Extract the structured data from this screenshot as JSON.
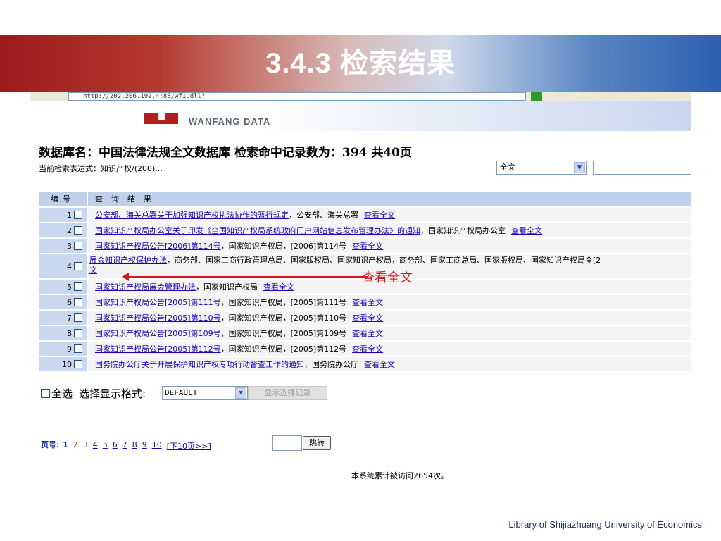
{
  "slide": {
    "title": "3.4.3 检索结果",
    "footer": "Library of Shijiazhuang University of Economics"
  },
  "browser": {
    "address": "http://202.206.192.4:88/wf1.dll?"
  },
  "brand": {
    "logo_text": "WANFANG DATA"
  },
  "summary": {
    "db_line": "数据库名：中国法律法规全文数据库  检索命中记录数为：394  共40页",
    "expression": "当前检索表达式：知识产权/(200)..."
  },
  "search": {
    "scope_value": "全文",
    "query_value": ""
  },
  "table": {
    "header_num": "编号",
    "header_result": "查询结果",
    "view_label": "查看全文",
    "rows": [
      {
        "num": "1",
        "title": "公安部、海关总署关于加强知识产权执法协作的暂行规定",
        "meta": "，公安部、海关总署"
      },
      {
        "num": "2",
        "title": "国家知识产权局办公室关于印发《全国知识产权局系统政府门户网站信息发布管理办法》的通知",
        "meta": "，国家知识产权局办公室"
      },
      {
        "num": "3",
        "title": "国家知识产权局公告[2006]第114号",
        "meta": "，国家知识产权局，[2006]第114号"
      },
      {
        "num": "4",
        "title": "展会知识产权保护办法",
        "meta": "，商务部、国家工商行政管理总局、国家版权局、国家知识产权局，商务部、国家工商总局、国家版权局、国家知识产权局令[2",
        "wrap": "文"
      },
      {
        "num": "5",
        "title": "国家知识产权局展会管理办法",
        "meta": "，国家知识产权局"
      },
      {
        "num": "6",
        "title": "国家知识产权局公告[2005]第111号",
        "meta": "，国家知识产权局，[2005]第111号"
      },
      {
        "num": "7",
        "title": "国家知识产权局公告[2005]第110号",
        "meta": "，国家知识产权局，[2005]第110号"
      },
      {
        "num": "8",
        "title": "国家知识产权局公告[2005]第109号",
        "meta": "，国家知识产权局，[2005]第109号"
      },
      {
        "num": "9",
        "title": "国家知识产权局公告[2005]第112号",
        "meta": "，国家知识产权局，[2005]第112号"
      },
      {
        "num": "10",
        "title": "国务院办公厅关于开展保护知识产权专项行动督查工作的通知",
        "meta": "，国务院办公厅"
      }
    ]
  },
  "annotation": {
    "text": "查看全文",
    "color": "#d6141c"
  },
  "controls": {
    "select_all": "全选",
    "format_label": "选择显示格式:",
    "format_value": "DEFAULT",
    "show_button": "显示选择记录"
  },
  "pager": {
    "label": "页号:",
    "current": "1",
    "pages_plain": [
      "2",
      "3"
    ],
    "pages_linked": [
      "4",
      "5",
      "6",
      "7",
      "8",
      "9",
      "10"
    ],
    "next": "[下10页>>]",
    "jump_button": "跳转"
  },
  "visits": "本系统累计被访问2654次。",
  "colors": {
    "link": "#1a00b4",
    "header_bg": "#bfd0ea",
    "brand_red": "#b01e1e"
  }
}
